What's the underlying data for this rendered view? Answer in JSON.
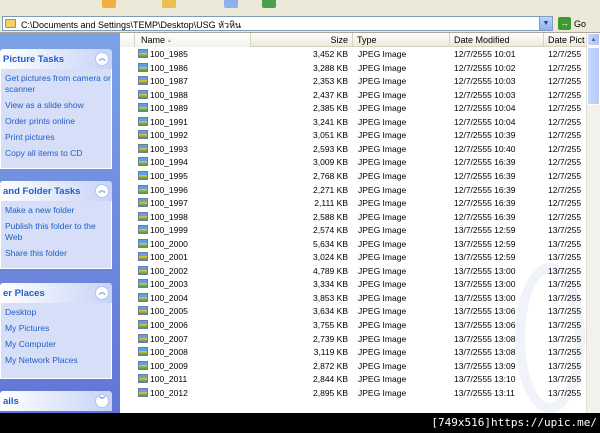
{
  "address": {
    "path": "C:\\Documents and Settings\\TEMP\\Desktop\\USG หัวหิน",
    "go_label": "Go"
  },
  "taskpane": {
    "picture_tasks": {
      "title": "Picture Tasks",
      "items": [
        "Get pictures from camera or scanner",
        "View as a slide show",
        "Order prints online",
        "Print pictures",
        "Copy all items to CD"
      ]
    },
    "file_folder_tasks": {
      "title": "and Folder Tasks",
      "items": [
        "Make a new folder",
        "Publish this folder to the Web",
        "Share this folder"
      ]
    },
    "other_places": {
      "title": "er Places",
      "items": [
        "Desktop",
        "My Pictures",
        "My Computer",
        "My Network Places"
      ]
    },
    "details": {
      "title": "ails"
    }
  },
  "columns": {
    "name": "Name",
    "size": "Size",
    "type": "Type",
    "date_modified": "Date Modified",
    "date_picture": "Date Pict"
  },
  "files": [
    {
      "name": "100_1985",
      "size": "3,452 KB",
      "type": "JPEG Image",
      "date": "12/7/2555 10:01",
      "date2": "12/7/255"
    },
    {
      "name": "100_1986",
      "size": "3,288 KB",
      "type": "JPEG Image",
      "date": "12/7/2555 10:02",
      "date2": "12/7/255"
    },
    {
      "name": "100_1987",
      "size": "2,353 KB",
      "type": "JPEG Image",
      "date": "12/7/2555 10:03",
      "date2": "12/7/255"
    },
    {
      "name": "100_1988",
      "size": "2,437 KB",
      "type": "JPEG Image",
      "date": "12/7/2555 10:03",
      "date2": "12/7/255"
    },
    {
      "name": "100_1989",
      "size": "2,385 KB",
      "type": "JPEG Image",
      "date": "12/7/2555 10:04",
      "date2": "12/7/255"
    },
    {
      "name": "100_1991",
      "size": "3,241 KB",
      "type": "JPEG Image",
      "date": "12/7/2555 10:04",
      "date2": "12/7/255"
    },
    {
      "name": "100_1992",
      "size": "3,051 KB",
      "type": "JPEG Image",
      "date": "12/7/2555 10:39",
      "date2": "12/7/255"
    },
    {
      "name": "100_1993",
      "size": "2,593 KB",
      "type": "JPEG Image",
      "date": "12/7/2555 10:40",
      "date2": "12/7/255"
    },
    {
      "name": "100_1994",
      "size": "3,009 KB",
      "type": "JPEG Image",
      "date": "12/7/2555 16:39",
      "date2": "12/7/255"
    },
    {
      "name": "100_1995",
      "size": "2,768 KB",
      "type": "JPEG Image",
      "date": "12/7/2555 16:39",
      "date2": "12/7/255"
    },
    {
      "name": "100_1996",
      "size": "2,271 KB",
      "type": "JPEG Image",
      "date": "12/7/2555 16:39",
      "date2": "12/7/255"
    },
    {
      "name": "100_1997",
      "size": "2,111 KB",
      "type": "JPEG Image",
      "date": "12/7/2555 16:39",
      "date2": "12/7/255"
    },
    {
      "name": "100_1998",
      "size": "2,588 KB",
      "type": "JPEG Image",
      "date": "12/7/2555 16:39",
      "date2": "12/7/255"
    },
    {
      "name": "100_1999",
      "size": "2,574 KB",
      "type": "JPEG Image",
      "date": "13/7/2555 12:59",
      "date2": "13/7/255"
    },
    {
      "name": "100_2000",
      "size": "5,634 KB",
      "type": "JPEG Image",
      "date": "13/7/2555 12:59",
      "date2": "13/7/255"
    },
    {
      "name": "100_2001",
      "size": "3,024 KB",
      "type": "JPEG Image",
      "date": "13/7/2555 12:59",
      "date2": "13/7/255"
    },
    {
      "name": "100_2002",
      "size": "4,789 KB",
      "type": "JPEG Image",
      "date": "13/7/2555 13:00",
      "date2": "13/7/255"
    },
    {
      "name": "100_2003",
      "size": "3,334 KB",
      "type": "JPEG Image",
      "date": "13/7/2555 13:00",
      "date2": "13/7/255"
    },
    {
      "name": "100_2004",
      "size": "3,853 KB",
      "type": "JPEG Image",
      "date": "13/7/2555 13:00",
      "date2": "13/7/255"
    },
    {
      "name": "100_2005",
      "size": "3,634 KB",
      "type": "JPEG Image",
      "date": "13/7/2555 13:06",
      "date2": "13/7/255"
    },
    {
      "name": "100_2006",
      "size": "3,755 KB",
      "type": "JPEG Image",
      "date": "13/7/2555 13:06",
      "date2": "13/7/255"
    },
    {
      "name": "100_2007",
      "size": "2,739 KB",
      "type": "JPEG Image",
      "date": "13/7/2555 13:08",
      "date2": "13/7/255"
    },
    {
      "name": "100_2008",
      "size": "3,119 KB",
      "type": "JPEG Image",
      "date": "13/7/2555 13:08",
      "date2": "13/7/255"
    },
    {
      "name": "100_2009",
      "size": "2,872 KB",
      "type": "JPEG Image",
      "date": "13/7/2555 13:09",
      "date2": "13/7/255"
    },
    {
      "name": "100_2011",
      "size": "2,844 KB",
      "type": "JPEG Image",
      "date": "13/7/2555 13:10",
      "date2": "13/7/255"
    },
    {
      "name": "100_2012",
      "size": "2,895 KB",
      "type": "JPEG Image",
      "date": "13/7/2555 13:11",
      "date2": "13/7/255"
    }
  ],
  "caption": "[749x516]https://upic.me/"
}
